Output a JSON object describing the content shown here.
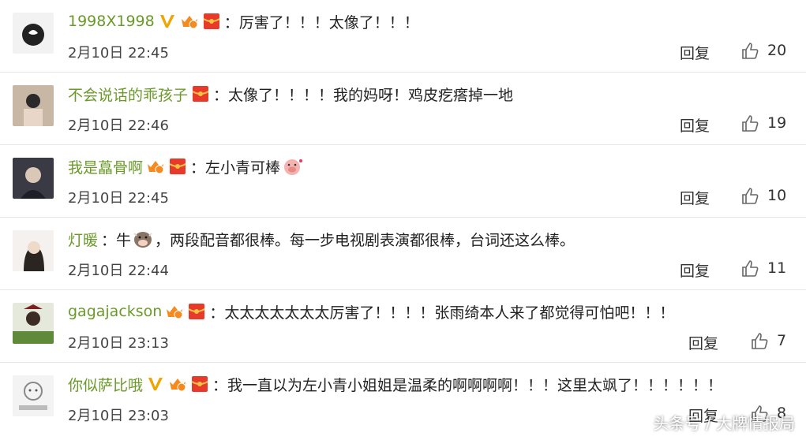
{
  "comments": [
    {
      "username": "1998X1998",
      "text": "：厉害了！！！太像了！！！",
      "date": "2月10日 22:45",
      "reply": "回复",
      "likes": "20"
    },
    {
      "username": "不会说话的乖孩子",
      "text": "：太像了！！！！我的妈呀！鸡皮疙瘩掉一地",
      "date": "2月10日 22:46",
      "reply": "回复",
      "likes": "19"
    },
    {
      "username": "我是藠骨啊",
      "text": "：左小青可棒",
      "date": "2月10日 22:45",
      "reply": "回复",
      "likes": "10"
    },
    {
      "username": "灯暖",
      "text_a": "：牛",
      "text_b": "，两段配音都很棒。每一步电视剧表演都很棒，台词还这么棒。",
      "date": "2月10日 22:44",
      "reply": "回复",
      "likes": "11"
    },
    {
      "username": "gagajackson",
      "text": "：太太太太太太太厉害了！！！！张雨绮本人来了都觉得可怕吧！！！",
      "date": "2月10日 23:13",
      "reply": "回复",
      "likes": "7"
    },
    {
      "username": "你似萨比哦",
      "text": "：我一直以为左小青小姐姐是温柔的啊啊啊啊！！！这里太飒了！！！！！！",
      "date": "2月10日 23:03",
      "reply": "回复",
      "likes": "8"
    }
  ],
  "watermark": "头条号 / 大牌情报局",
  "colors": {
    "username": "#6b9a2b",
    "text": "#222222",
    "divider": "#e6e6e6"
  },
  "icons": {
    "like": "thumbs-up-icon",
    "verified": "v-badge-icon",
    "level": "crown-level-icon",
    "redpacket": "red-packet-icon"
  }
}
